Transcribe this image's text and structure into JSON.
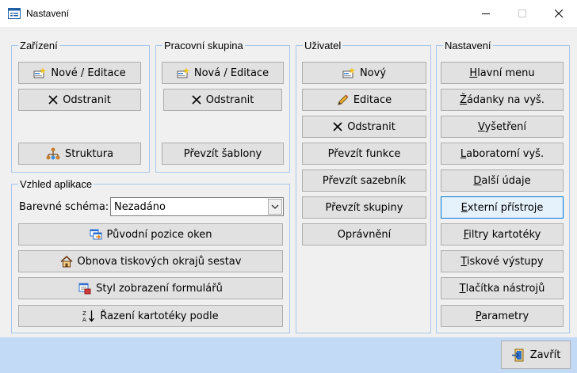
{
  "window": {
    "title": "Nastavení"
  },
  "icons": {
    "app": "form-icon",
    "minimize": "minimize-icon",
    "maximize": "maximize-icon",
    "close": "close-icon"
  },
  "zarizeni": {
    "legend": "Zařízení",
    "new_edit": "Nové / Editace",
    "remove": "Odstranit",
    "structure": "Struktura"
  },
  "skupina": {
    "legend": "Pracovní skupina",
    "new_edit": "Nová / Editace",
    "remove": "Odstranit",
    "templates": "Převzít šablony"
  },
  "uzivatel": {
    "legend": "Uživatel",
    "new": "Nový",
    "edit": "Editace",
    "remove": "Odstranit",
    "take_functions": "Převzít funkce",
    "take_pricelist": "Převzít sazebník",
    "take_groups": "Převzít skupiny",
    "permissions": "Oprávnění"
  },
  "vzhled": {
    "legend": "Vzhled aplikace",
    "scheme_label": "Barevné schéma:",
    "scheme_value": "Nezadáno",
    "window_pos": "Původní pozice oken",
    "print_margins": "Obnova tiskových okrajů sestav",
    "form_style": "Styl zobrazení formulářů",
    "sort": "Řazení kartotéky podle"
  },
  "nastaveni": {
    "legend": "Nastavení",
    "items": [
      "Hlavní menu",
      "Žádanky na vyš.",
      "Vyšetření",
      "Laboratorní vyš.",
      "Další údaje",
      "Externí přístroje",
      "Filtry kartotéky",
      "Tiskové výstupy",
      "Tlačítka nástrojů",
      "Parametry"
    ]
  },
  "footer": {
    "close": "Zavřít"
  }
}
